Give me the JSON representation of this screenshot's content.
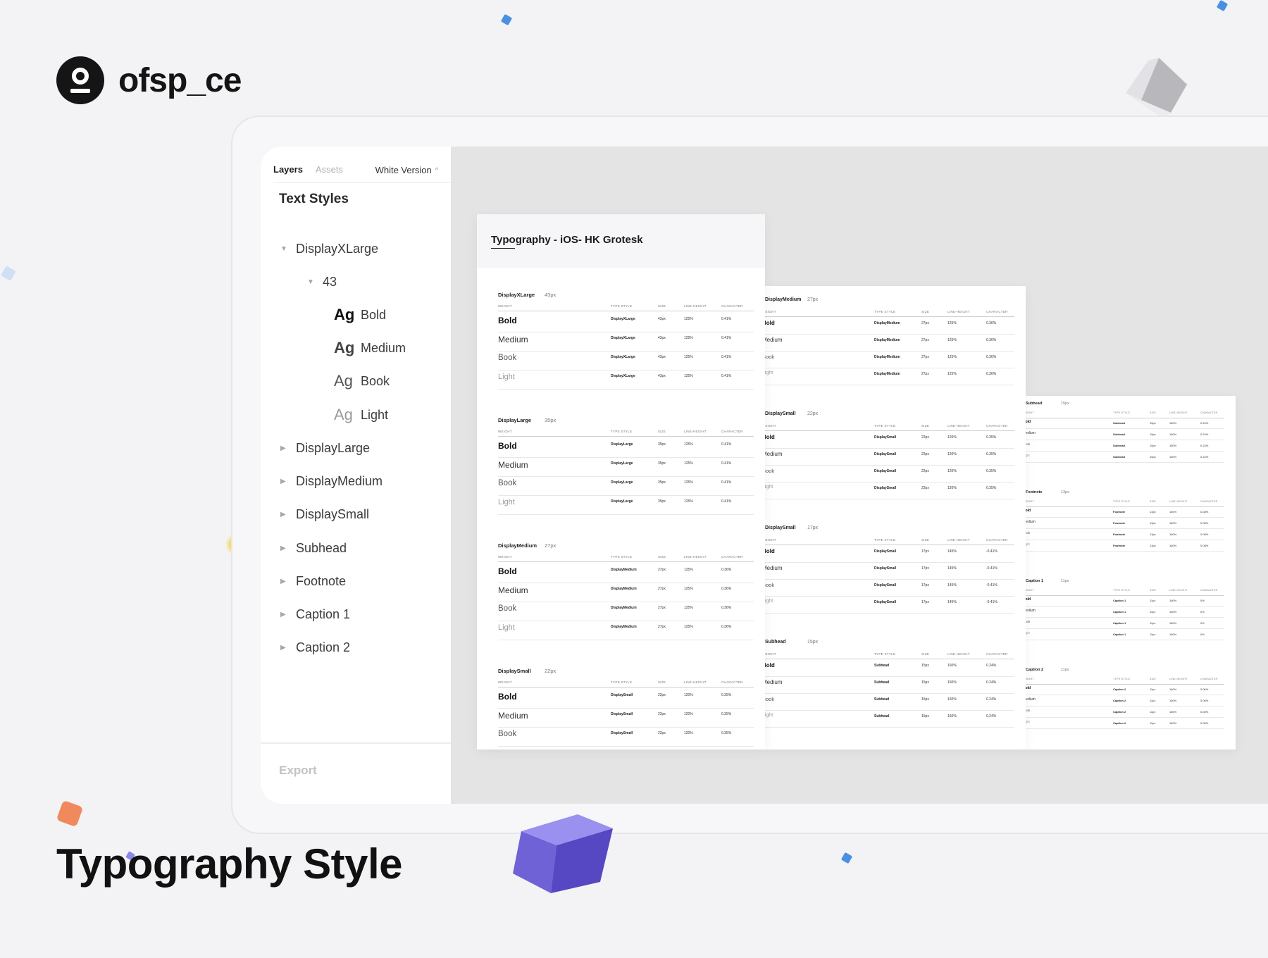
{
  "brand": {
    "name": "ofsp_ce"
  },
  "page_title": "Typography Style",
  "panel": {
    "tabs": [
      "Layers",
      "Assets"
    ],
    "version_label": "White Version",
    "title": "Text Styles",
    "tree": [
      {
        "label": "DisplayXLarge",
        "expanded": true
      },
      {
        "label": "43",
        "expanded": true
      },
      {
        "ag": "Ag",
        "label": "Bold"
      },
      {
        "ag": "Ag",
        "label": "Medium"
      },
      {
        "ag": "Ag",
        "label": "Book"
      },
      {
        "ag": "Ag",
        "label": "Light"
      },
      {
        "label": "DisplayLarge"
      },
      {
        "label": "DisplayMedium"
      },
      {
        "label": "DisplaySmall"
      },
      {
        "label": "Subhead"
      },
      {
        "label": "Footnote"
      },
      {
        "label": "Caption 1"
      },
      {
        "label": "Caption 2"
      }
    ],
    "export_label": "Export"
  },
  "sheet1": {
    "title": "Typography - iOS- HK Grotesk",
    "headers": [
      "WEIGHT",
      "TYPE STYLE",
      "SIZE",
      "LINE-HEIGHT",
      "CHARACTER"
    ],
    "sections": [
      {
        "name": "DisplayXLarge",
        "size": "43px",
        "style": "DisplayXLarge",
        "px": "43px",
        "lh": "125%",
        "ch": "0.41%",
        "weights": [
          "Bold",
          "Medium",
          "Book",
          "Light"
        ]
      },
      {
        "name": "DisplayLarge",
        "size": "35px",
        "style": "DisplayLarge",
        "px": "35px",
        "lh": "125%",
        "ch": "0.41%",
        "weights": [
          "Bold",
          "Medium",
          "Book",
          "Light"
        ]
      },
      {
        "name": "DisplayMedium",
        "size": "27px",
        "style": "DisplayMedium",
        "px": "27px",
        "lh": "125%",
        "ch": "0.36%",
        "weights": [
          "Bold",
          "Medium",
          "Book",
          "Light"
        ]
      },
      {
        "name": "DisplaySmall",
        "size": "22px",
        "style": "DisplaySmall",
        "px": "22px",
        "lh": "120%",
        "ch": "0.35%",
        "weights": [
          "Bold",
          "Medium",
          "Book"
        ]
      }
    ]
  },
  "sheet2": {
    "headers": [
      "WEIGHT",
      "TYPE STYLE",
      "SIZE",
      "LINE-HEIGHT",
      "CHARACTER"
    ],
    "sections": [
      {
        "name": "DisplayMedium",
        "size": "27px",
        "style": "DisplayMedium",
        "px": "27px",
        "lh": "125%",
        "ch": "0.36%",
        "weights": [
          "Bold",
          "Medium",
          "Book",
          "Light"
        ]
      },
      {
        "name": "DisplaySmall",
        "size": "22px",
        "style": "DisplaySmall",
        "px": "22px",
        "lh": "120%",
        "ch": "0.35%",
        "weights": [
          "Bold",
          "Medium",
          "Book",
          "Light"
        ]
      },
      {
        "name": "DisplaySmall",
        "size": "17px",
        "style": "DisplaySmall",
        "px": "17px",
        "lh": "145%",
        "ch": "-0.41%",
        "weights": [
          "Bold",
          "Medium",
          "Book",
          "Light"
        ]
      },
      {
        "name": "Subhead",
        "size": "15px",
        "style": "Subhead",
        "px": "15px",
        "lh": "160%",
        "ch": "0.24%",
        "weights": [
          "Bold",
          "Medium",
          "Book",
          "Light"
        ]
      }
    ]
  },
  "sheet3": {
    "headers": [
      "WEIGHT",
      "TYPE STYLE",
      "SIZE",
      "LINE-HEIGHT",
      "CHARACTER"
    ],
    "sections": [
      {
        "name": "Subhead",
        "size": "15px",
        "style": "Subhead",
        "px": "15px",
        "lh": "160%",
        "ch": "0.24%",
        "weights": [
          "Bold",
          "Medium",
          "Book",
          "Light"
        ]
      },
      {
        "name": "Footnote",
        "size": "13px",
        "style": "Footnote",
        "px": "13px",
        "lh": "160%",
        "ch": "0.08%",
        "weights": [
          "Bold",
          "Medium",
          "Book",
          "Light"
        ]
      },
      {
        "name": "Caption 1",
        "size": "11px",
        "style": "Caption 1",
        "px": "11px",
        "lh": "160%",
        "ch": "0%",
        "weights": [
          "Bold",
          "Medium",
          "Book",
          "Light"
        ]
      },
      {
        "name": "Caption 2",
        "size": "11px",
        "style": "Caption 2",
        "px": "11px",
        "lh": "160%",
        "ch": "0.06%",
        "weights": [
          "Bold",
          "Medium",
          "Book",
          "Light"
        ]
      }
    ]
  },
  "colors": {
    "background": "#f3f3f5",
    "accent_purple": "#7b6cf0",
    "accent_orange": "#f08a5d",
    "accent_blue": "#4a90e2",
    "accent_yellow": "#f4d21c"
  }
}
